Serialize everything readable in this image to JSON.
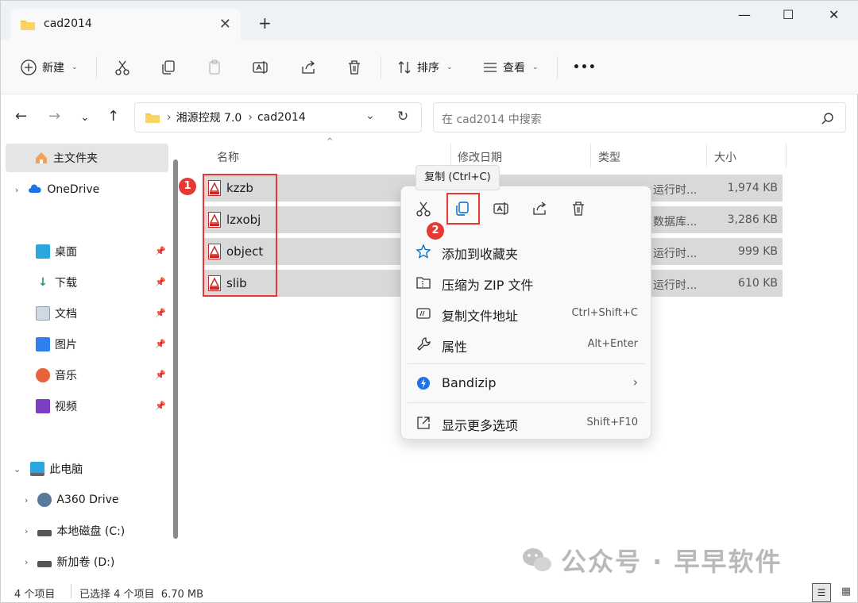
{
  "window": {
    "tab_title": "cad2014",
    "new_tab": "+",
    "minimize": "—",
    "maximize": "☐",
    "close": "✕"
  },
  "toolbar": {
    "new_label": "新建",
    "sort_label": "排序",
    "view_label": "查看",
    "more": "•••"
  },
  "address": {
    "crumbs": [
      "湘源控规 7.0",
      "cad2014"
    ],
    "search_placeholder": "在 cad2014 中搜索"
  },
  "sidebar": {
    "home": "主文件夹",
    "onedrive": "OneDrive",
    "quick": [
      "桌面",
      "下载",
      "文档",
      "图片",
      "音乐",
      "视频"
    ],
    "pc": "此电脑",
    "drives": [
      "A360 Drive",
      "本地磁盘 (C:)",
      "新加卷 (D:)"
    ]
  },
  "columns": {
    "name": "名称",
    "date": "修改日期",
    "type": "类型",
    "size": "大小"
  },
  "files": [
    {
      "name": "kzzb",
      "type": "运行时...",
      "size": "1,974 KB"
    },
    {
      "name": "lzxobj",
      "type": "数据库...",
      "size": "3,286 KB"
    },
    {
      "name": "object",
      "type": "运行时...",
      "size": "999 KB"
    },
    {
      "name": "slib",
      "type": "运行时...",
      "size": "610 KB"
    }
  ],
  "badges": {
    "one": "1",
    "two": "2"
  },
  "tooltip": "复制 (Ctrl+C)",
  "context_menu": {
    "items": [
      {
        "label": "添加到收藏夹",
        "key": ""
      },
      {
        "label": "压缩为 ZIP 文件",
        "key": ""
      },
      {
        "label": "复制文件地址",
        "key": "Ctrl+Shift+C"
      },
      {
        "label": "属性",
        "key": "Alt+Enter"
      },
      {
        "label": "Bandizip",
        "key": "›"
      },
      {
        "label": "显示更多选项",
        "key": "Shift+F10"
      }
    ]
  },
  "status": {
    "count": "4 个项目",
    "selected": "已选择 4 个项目  6.70 MB"
  },
  "watermark": "公众号 · 早早软件",
  "colors": {
    "accent": "#0067c0",
    "highlight_red": "#e53935",
    "selected_row": "#d9d9d9"
  }
}
